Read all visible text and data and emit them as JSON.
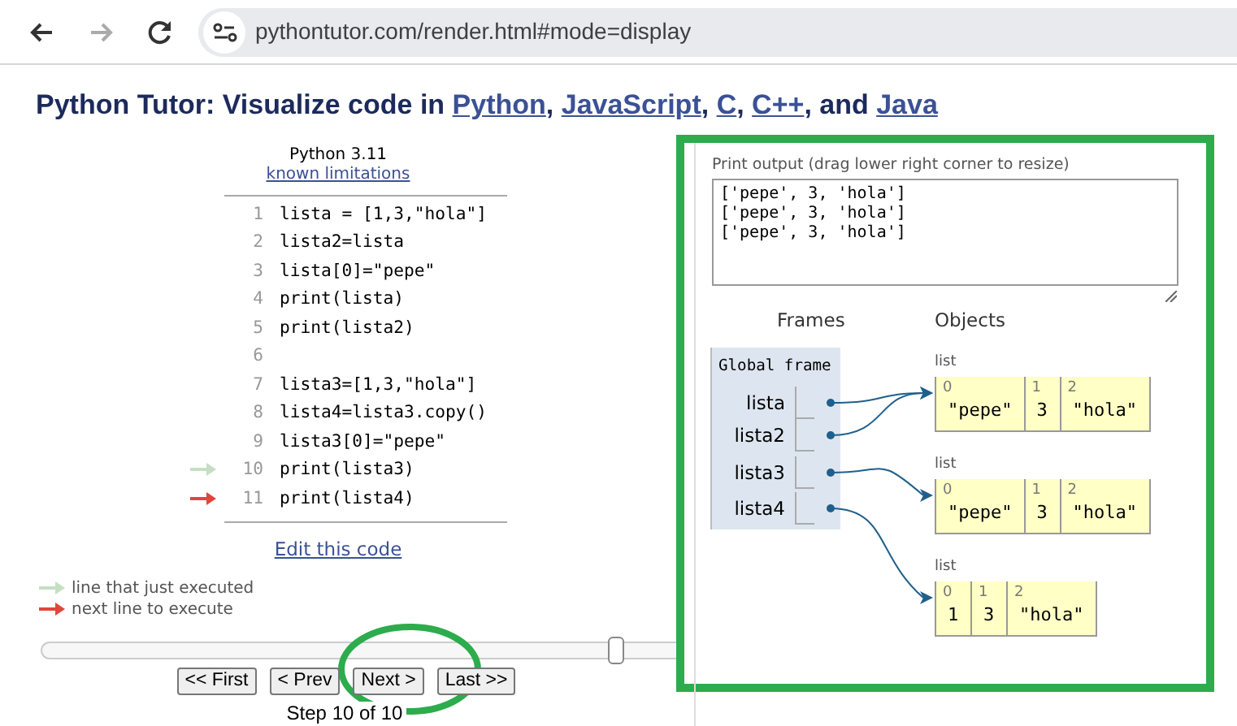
{
  "browser": {
    "url": "pythontutor.com/render.html#mode=display"
  },
  "heading": [
    {
      "kind": "text",
      "text": "Python Tutor: Visualize code in "
    },
    {
      "kind": "link",
      "text": "Python"
    },
    {
      "kind": "text",
      "text": ", "
    },
    {
      "kind": "link",
      "text": "JavaScript"
    },
    {
      "kind": "text",
      "text": ", "
    },
    {
      "kind": "link",
      "text": "C"
    },
    {
      "kind": "text",
      "text": ", "
    },
    {
      "kind": "link",
      "text": "C++"
    },
    {
      "kind": "text",
      "text": ", and "
    },
    {
      "kind": "link",
      "text": "Java"
    }
  ],
  "editor": {
    "language": "Python 3.11",
    "limitations_link": "known limitations",
    "lines": [
      {
        "number": "1",
        "text": "lista = [1,3,\"hola\"]",
        "just_executed": false,
        "next_to_execute": false
      },
      {
        "number": "2",
        "text": "lista2=lista",
        "just_executed": false,
        "next_to_execute": false
      },
      {
        "number": "3",
        "text": "lista[0]=\"pepe\"",
        "just_executed": false,
        "next_to_execute": false
      },
      {
        "number": "4",
        "text": "print(lista)",
        "just_executed": false,
        "next_to_execute": false
      },
      {
        "number": "5",
        "text": "print(lista2)",
        "just_executed": false,
        "next_to_execute": false
      },
      {
        "number": "6",
        "just_executed": false,
        "next_to_execute": false
      },
      {
        "number": "7",
        "text": "lista3=[1,3,\"hola\"]",
        "just_executed": false,
        "next_to_execute": false
      },
      {
        "number": "8",
        "text": "lista4=lista3.copy()",
        "just_executed": false,
        "next_to_execute": false
      },
      {
        "number": "9",
        "text": "lista3[0]=\"pepe\"",
        "just_executed": false,
        "next_to_execute": false
      },
      {
        "number": "10",
        "text": "print(lista3)",
        "just_executed": true,
        "next_to_execute": false
      },
      {
        "number": "11",
        "text": "print(lista4)",
        "just_executed": false,
        "next_to_execute": true
      }
    ],
    "edit_link": "Edit this code"
  },
  "legend": [
    {
      "kind": "executed",
      "text": "line that just executed"
    },
    {
      "kind": "next",
      "text": "next line to execute"
    }
  ],
  "slider": {
    "level": 0.905
  },
  "nav_buttons": [
    "<< First",
    "< Prev",
    "Next >",
    "Last >>"
  ],
  "step": "Step 10 of 10",
  "output": {
    "label": "Print output (drag lower right corner to resize)",
    "lines": [
      "['pepe', 3, 'hola']",
      "['pepe', 3, 'hola']",
      "['pepe', 3, 'hola']"
    ]
  },
  "frames_heading": "Frames",
  "objects_heading": "Objects",
  "frame": {
    "title": "Global frame",
    "variables": [
      {
        "name": "lista",
        "shares_previous_object": false
      },
      {
        "name": "lista2",
        "shares_previous_object": true
      },
      {
        "name": "lista3",
        "shares_previous_object": false
      },
      {
        "name": "lista4",
        "shares_previous_object": false
      }
    ]
  },
  "objects": [
    {
      "type": "list",
      "cells": [
        {
          "index": "0",
          "value": "\"pepe\""
        },
        {
          "index": "1",
          "value": "3"
        },
        {
          "index": "2",
          "value": "\"hola\""
        }
      ]
    },
    {
      "type": "list",
      "cells": [
        {
          "index": "0",
          "value": "\"pepe\""
        },
        {
          "index": "1",
          "value": "3"
        },
        {
          "index": "2",
          "value": "\"hola\""
        }
      ]
    },
    {
      "type": "list",
      "cells": [
        {
          "index": "0",
          "value": "1"
        },
        {
          "index": "1",
          "value": "3"
        },
        {
          "index": "2",
          "value": "\"hola\""
        }
      ]
    }
  ]
}
